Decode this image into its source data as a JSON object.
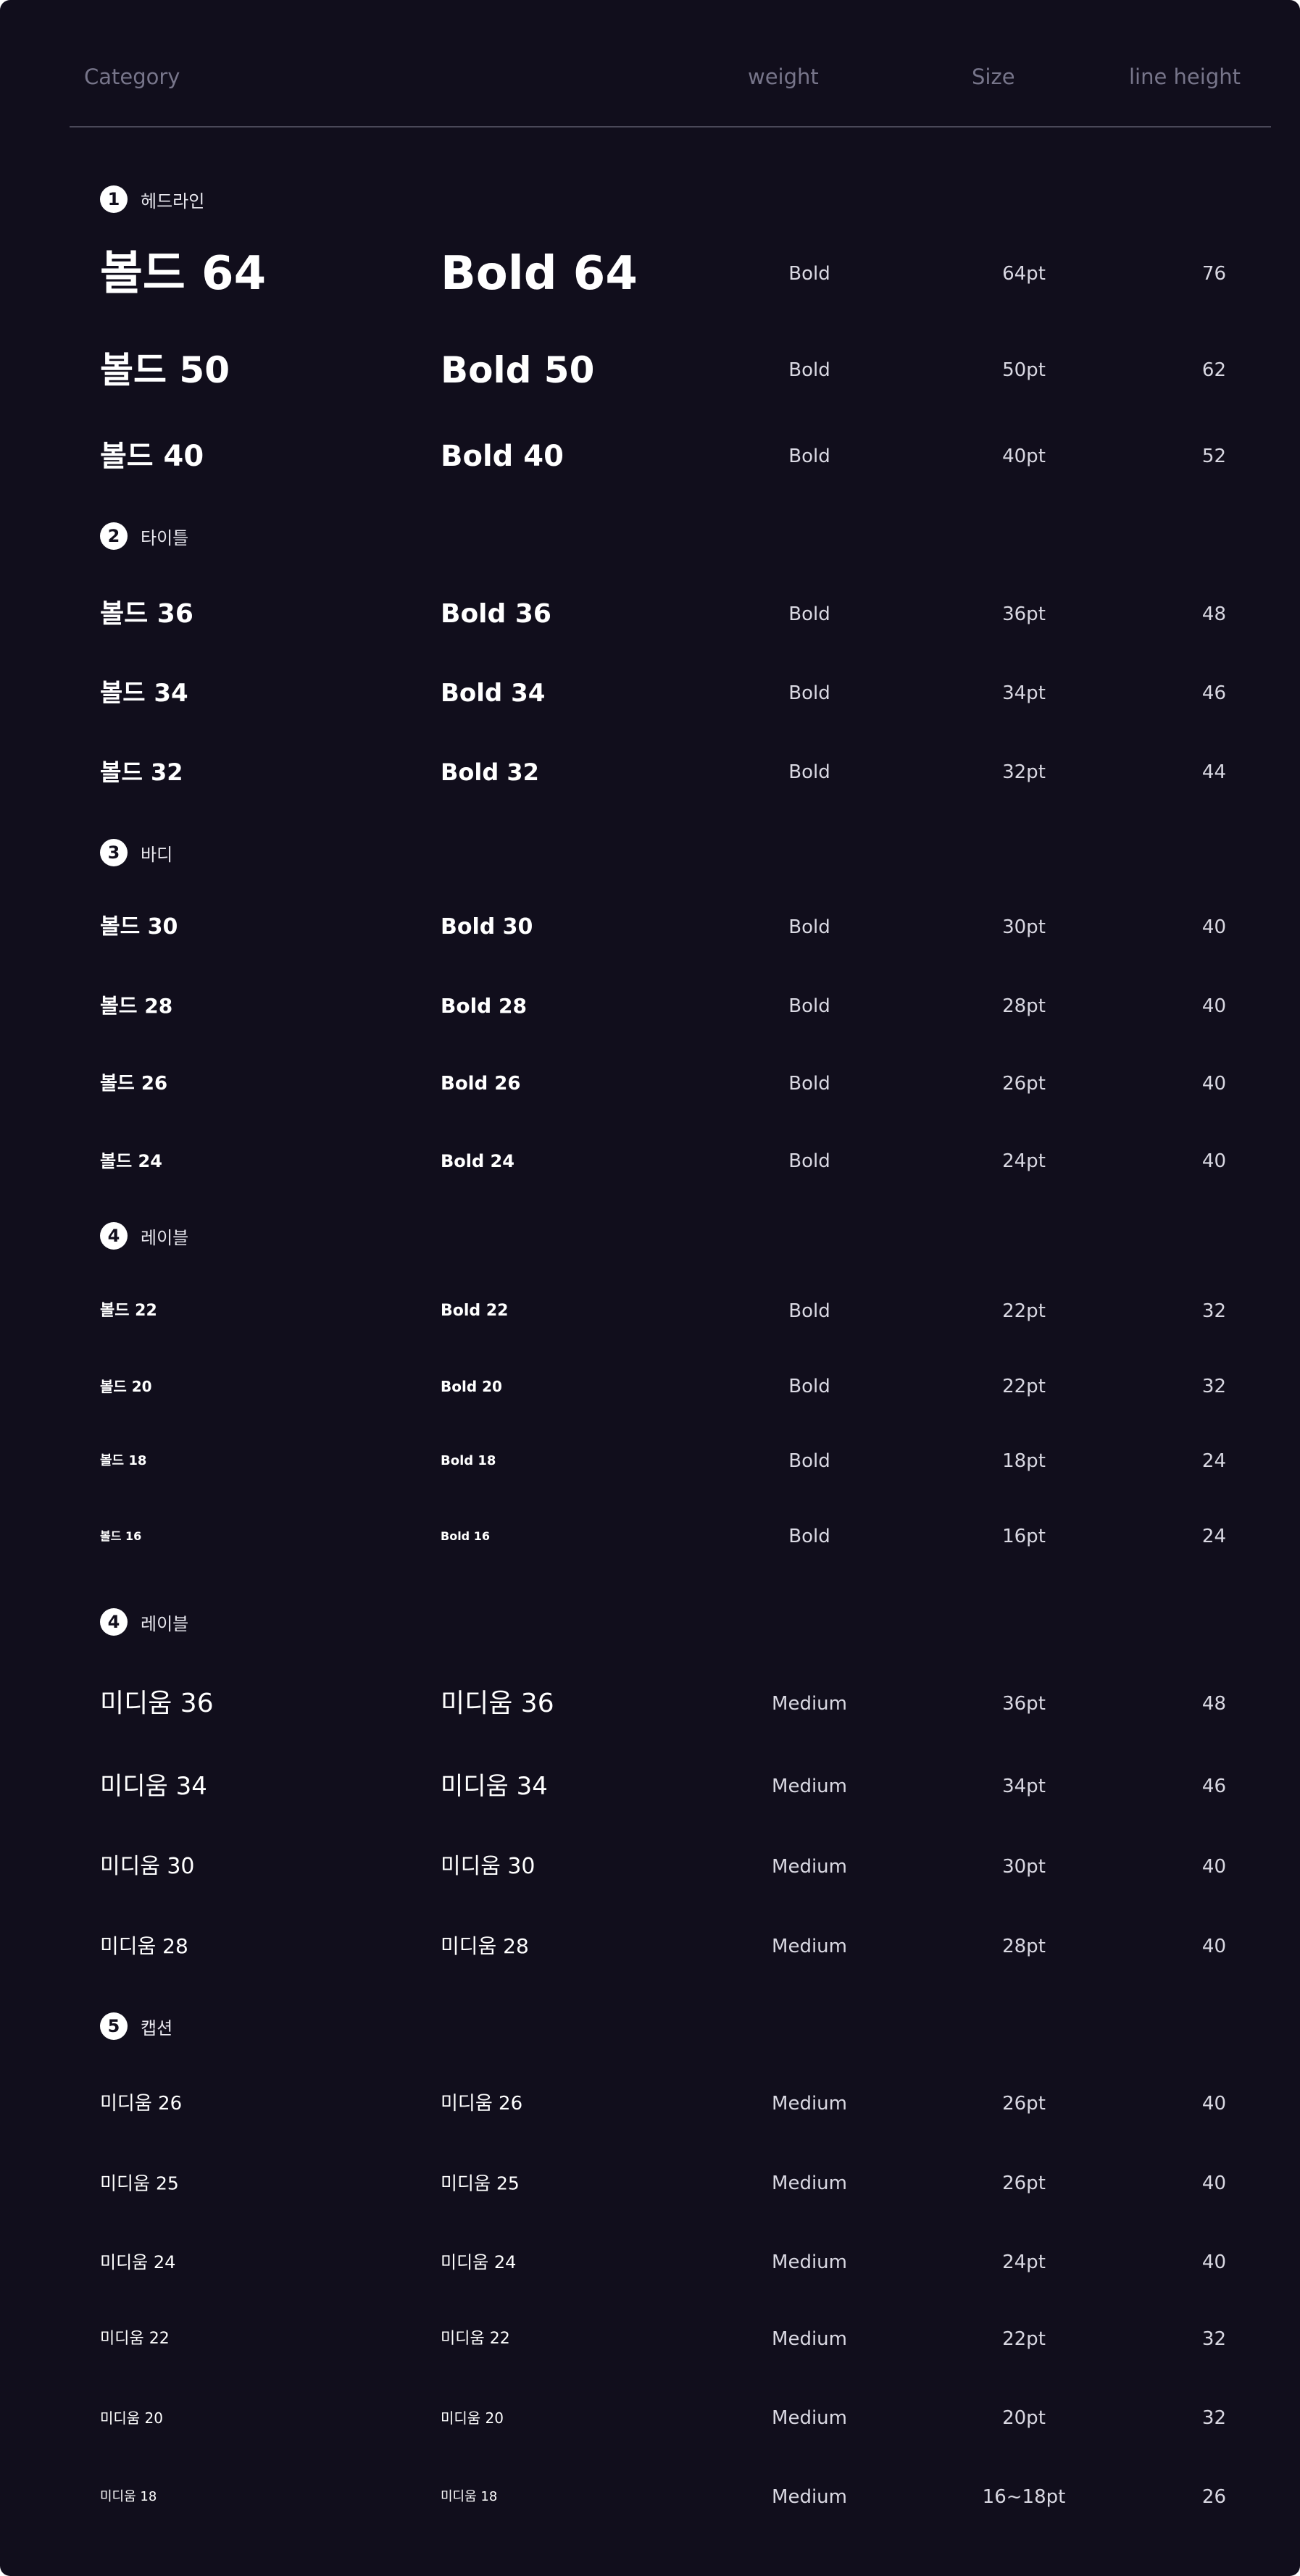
{
  "header": {
    "category": "Category",
    "weight": "weight",
    "size": "Size",
    "line_height": "line height"
  },
  "sections": [
    {
      "number": "1",
      "label": "헤드라인"
    },
    {
      "number": "2",
      "label": "타이틀"
    },
    {
      "number": "3",
      "label": "바디"
    },
    {
      "number": "4",
      "label": "레이블"
    },
    {
      "number": "4",
      "label": "레이블"
    },
    {
      "number": "5",
      "label": "캡션"
    }
  ],
  "rows": [
    {
      "ko": "볼드 64",
      "en": "Bold 64",
      "weight": "Bold",
      "size": "64pt",
      "line_height": "76"
    },
    {
      "ko": "볼드 50",
      "en": "Bold 50",
      "weight": "Bold",
      "size": "50pt",
      "line_height": "62"
    },
    {
      "ko": "볼드 40",
      "en": "Bold 40",
      "weight": "Bold",
      "size": "40pt",
      "line_height": "52"
    },
    {
      "ko": "볼드 36",
      "en": "Bold 36",
      "weight": "Bold",
      "size": "36pt",
      "line_height": "48"
    },
    {
      "ko": "볼드 34",
      "en": "Bold 34",
      "weight": "Bold",
      "size": "34pt",
      "line_height": "46"
    },
    {
      "ko": "볼드 32",
      "en": "Bold 32",
      "weight": "Bold",
      "size": "32pt",
      "line_height": "44"
    },
    {
      "ko": "볼드 30",
      "en": "Bold 30",
      "weight": "Bold",
      "size": "30pt",
      "line_height": "40"
    },
    {
      "ko": "볼드 28",
      "en": "Bold 28",
      "weight": "Bold",
      "size": "28pt",
      "line_height": "40"
    },
    {
      "ko": "볼드 26",
      "en": "Bold 26",
      "weight": "Bold",
      "size": "26pt",
      "line_height": "40"
    },
    {
      "ko": "볼드 24",
      "en": "Bold 24",
      "weight": "Bold",
      "size": "24pt",
      "line_height": "40"
    },
    {
      "ko": "볼드 22",
      "en": "Bold 22",
      "weight": "Bold",
      "size": "22pt",
      "line_height": "32"
    },
    {
      "ko": "볼드 20",
      "en": "Bold 20",
      "weight": "Bold",
      "size": "22pt",
      "line_height": "32"
    },
    {
      "ko": "볼드 18",
      "en": "Bold 18",
      "weight": "Bold",
      "size": "18pt",
      "line_height": "24"
    },
    {
      "ko": "볼드 16",
      "en": "Bold 16",
      "weight": "Bold",
      "size": "16pt",
      "line_height": "24"
    },
    {
      "ko": "미디움 36",
      "en": "미디움 36",
      "weight": "Medium",
      "size": "36pt",
      "line_height": "48"
    },
    {
      "ko": "미디움 34",
      "en": "미디움 34",
      "weight": "Medium",
      "size": "34pt",
      "line_height": "46"
    },
    {
      "ko": "미디움 30",
      "en": "미디움 30",
      "weight": "Medium",
      "size": "30pt",
      "line_height": "40"
    },
    {
      "ko": "미디움 28",
      "en": "미디움 28",
      "weight": "Medium",
      "size": "28pt",
      "line_height": "40"
    },
    {
      "ko": "미디움 26",
      "en": "미디움 26",
      "weight": "Medium",
      "size": "26pt",
      "line_height": "40"
    },
    {
      "ko": "미디움 25",
      "en": "미디움 25",
      "weight": "Medium",
      "size": "26pt",
      "line_height": "40"
    },
    {
      "ko": "미디움 24",
      "en": "미디움 24",
      "weight": "Medium",
      "size": "24pt",
      "line_height": "40"
    },
    {
      "ko": "미디움 22",
      "en": "미디움 22",
      "weight": "Medium",
      "size": "22pt",
      "line_height": "32"
    },
    {
      "ko": "미디움 20",
      "en": "미디움 20",
      "weight": "Medium",
      "size": "20pt",
      "line_height": "32"
    },
    {
      "ko": "미디움 18",
      "en": "미디움 18",
      "weight": "Medium",
      "size": "16~18pt",
      "line_height": "26"
    }
  ],
  "colors": {
    "background": "#110e1c",
    "header_text": "#77758a",
    "divider": "#4a4858",
    "sample_text": "#ffffff",
    "value_text": "#d9d8e2"
  }
}
